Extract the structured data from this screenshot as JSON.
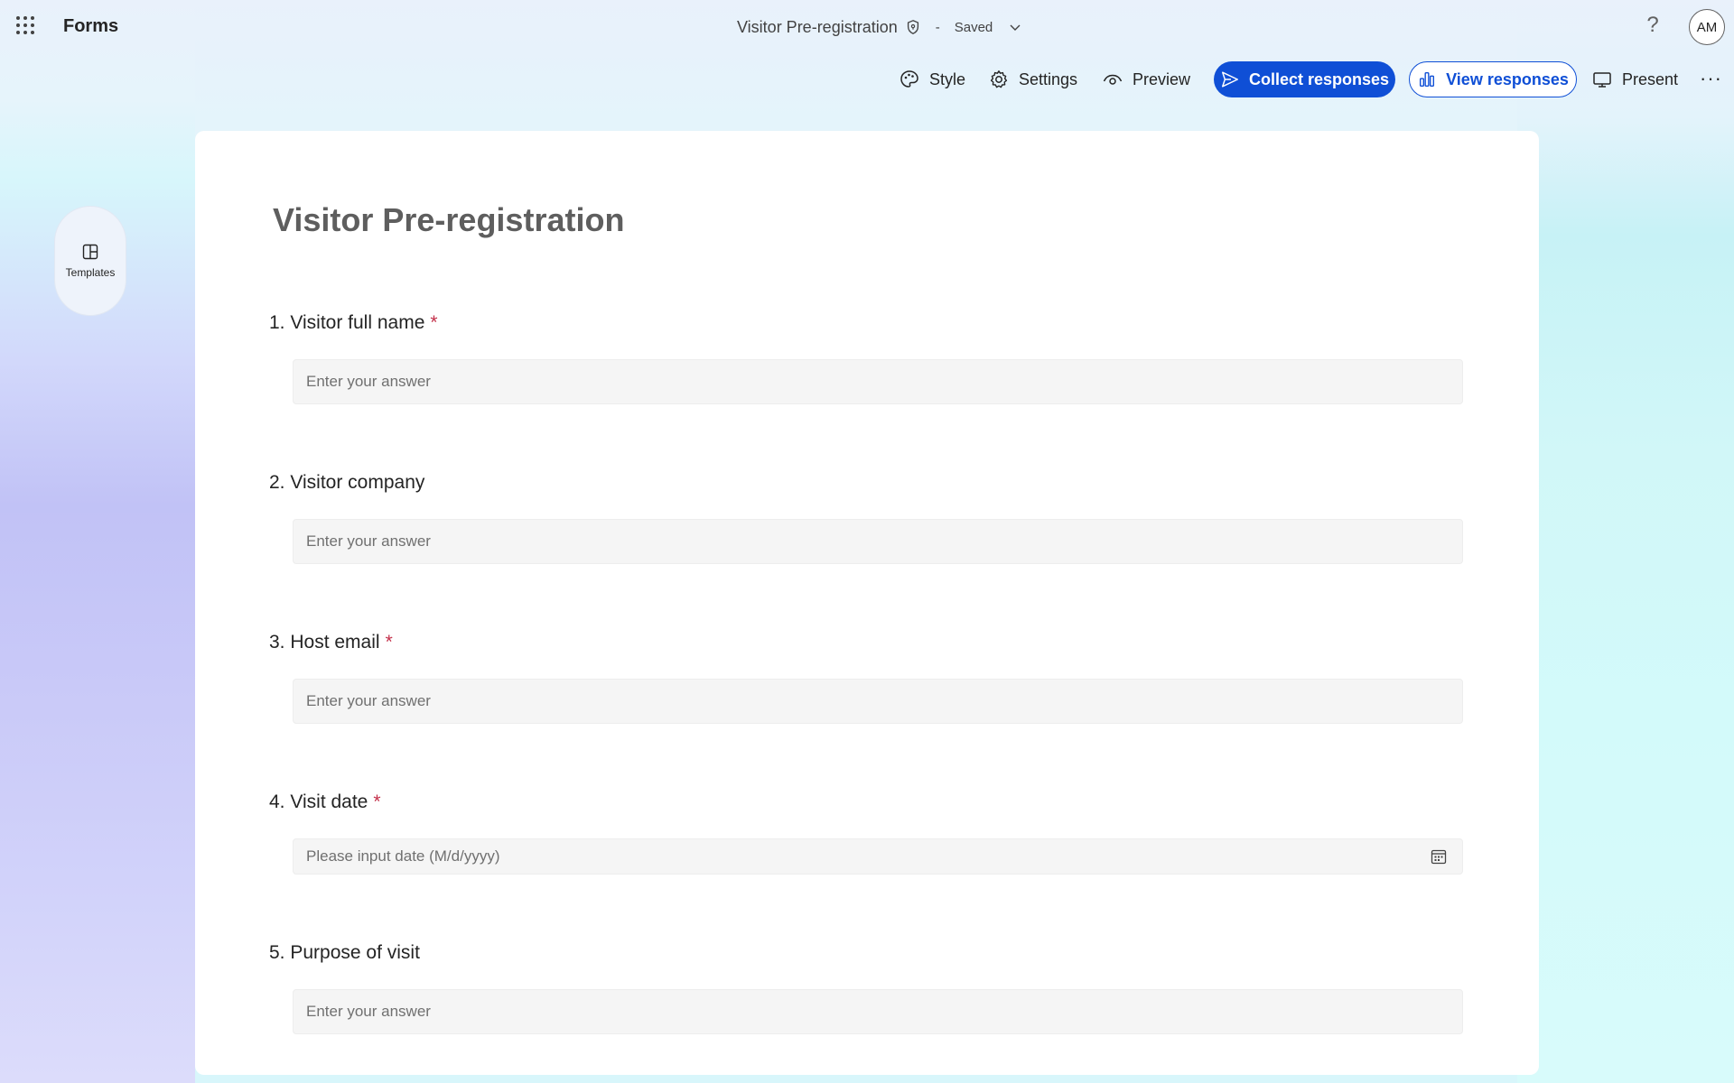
{
  "header": {
    "app_name": "Forms",
    "doc_title": "Visitor Pre-registration",
    "separator": "-",
    "save_status": "Saved",
    "help_label": "?",
    "user_initials": "AM"
  },
  "toolbar": {
    "style_label": "Style",
    "settings_label": "Settings",
    "preview_label": "Preview",
    "collect_label": "Collect responses",
    "view_label": "View responses",
    "present_label": "Present",
    "more_label": "···"
  },
  "sidebar": {
    "templates_label": "Templates"
  },
  "form": {
    "title": "Visitor Pre-registration",
    "required_marker": "*",
    "questions": [
      {
        "number": "1.",
        "label": "Visitor full name",
        "required": true,
        "placeholder": "Enter your answer"
      },
      {
        "number": "2.",
        "label": "Visitor company",
        "required": false,
        "placeholder": "Enter your answer"
      },
      {
        "number": "3.",
        "label": "Host email",
        "required": true,
        "placeholder": "Enter your answer"
      },
      {
        "number": "4.",
        "label": "Visit date",
        "required": true,
        "placeholder": "Please input date (M/d/yyyy)"
      },
      {
        "number": "5.",
        "label": "Purpose of visit",
        "required": false,
        "placeholder": "Enter your answer"
      }
    ]
  },
  "colors": {
    "accent": "#0f4fd6",
    "required": "#c4314b"
  },
  "icons": [
    "app-launcher-icon",
    "shield-icon",
    "chevron-down-icon",
    "palette-icon",
    "gear-icon",
    "eye-icon",
    "send-icon",
    "bar-chart-icon",
    "monitor-icon",
    "templates-icon",
    "calendar-icon"
  ]
}
